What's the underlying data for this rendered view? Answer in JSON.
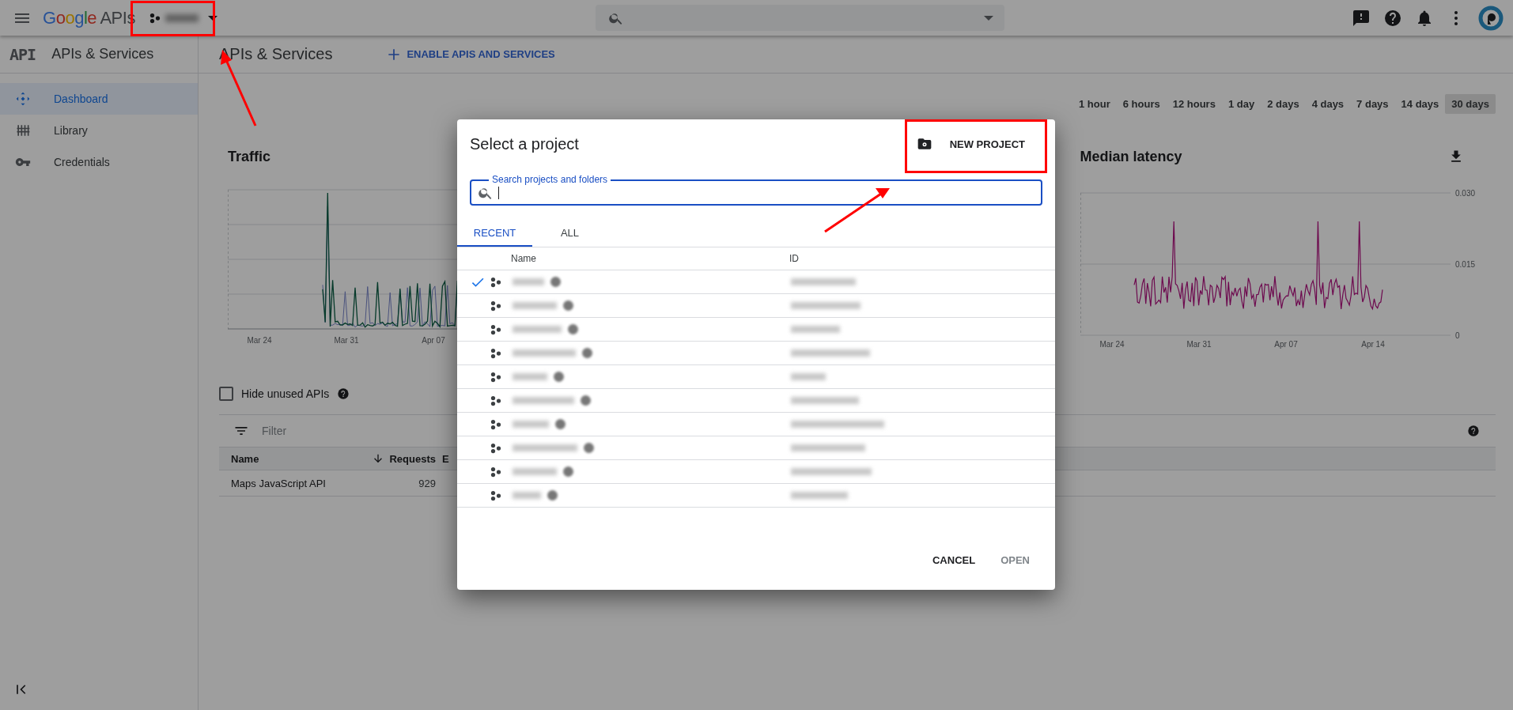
{
  "topbar": {
    "logo_brand": "Google",
    "logo_product": "APIs"
  },
  "sidebar": {
    "logo_text": "API",
    "title": "APIs & Services",
    "items": [
      {
        "label": "Dashboard",
        "selected": true
      },
      {
        "label": "Library",
        "selected": false
      },
      {
        "label": "Credentials",
        "selected": false
      }
    ]
  },
  "header": {
    "title": "APIs & Services",
    "enable_button": "ENABLE APIS AND SERVICES"
  },
  "time_ranges": [
    {
      "label": "1 hour",
      "selected": false
    },
    {
      "label": "6 hours",
      "selected": false
    },
    {
      "label": "12 hours",
      "selected": false
    },
    {
      "label": "1 day",
      "selected": false
    },
    {
      "label": "2 days",
      "selected": false
    },
    {
      "label": "4 days",
      "selected": false
    },
    {
      "label": "7 days",
      "selected": false
    },
    {
      "label": "14 days",
      "selected": false
    },
    {
      "label": "30 days",
      "selected": true
    }
  ],
  "traffic": {
    "title": "Traffic",
    "x_labels": [
      "Mar 24",
      "Mar 31",
      "Apr 07"
    ]
  },
  "latency": {
    "title": "Median latency",
    "x_labels": [
      "Mar 24",
      "Mar 31",
      "Apr 07",
      "Apr 14"
    ],
    "y_labels": [
      "0.030",
      "0.015",
      "0"
    ]
  },
  "hide_unused": {
    "label": "Hide unused APIs",
    "checked": false
  },
  "filter": {
    "placeholder": "Filter"
  },
  "api_table": {
    "columns": [
      "Name",
      "Requests",
      "E"
    ],
    "rows": [
      {
        "name": "Maps JavaScript API",
        "requests": "929"
      }
    ]
  },
  "dialog": {
    "title": "Select a project",
    "new_project": "NEW PROJECT",
    "search_label": "Search projects and folders",
    "tabs": [
      {
        "label": "RECENT",
        "selected": true
      },
      {
        "label": "ALL",
        "selected": false
      }
    ],
    "columns": [
      "Name",
      "ID"
    ],
    "projects": [
      {
        "selected": true
      },
      {
        "selected": false
      },
      {
        "selected": false
      },
      {
        "selected": false
      },
      {
        "selected": false
      },
      {
        "selected": false
      },
      {
        "selected": false
      },
      {
        "selected": false
      },
      {
        "selected": false
      },
      {
        "selected": false
      }
    ],
    "buttons": [
      {
        "label": "CANCEL",
        "disabled": false
      },
      {
        "label": "OPEN",
        "disabled": true
      }
    ]
  }
}
